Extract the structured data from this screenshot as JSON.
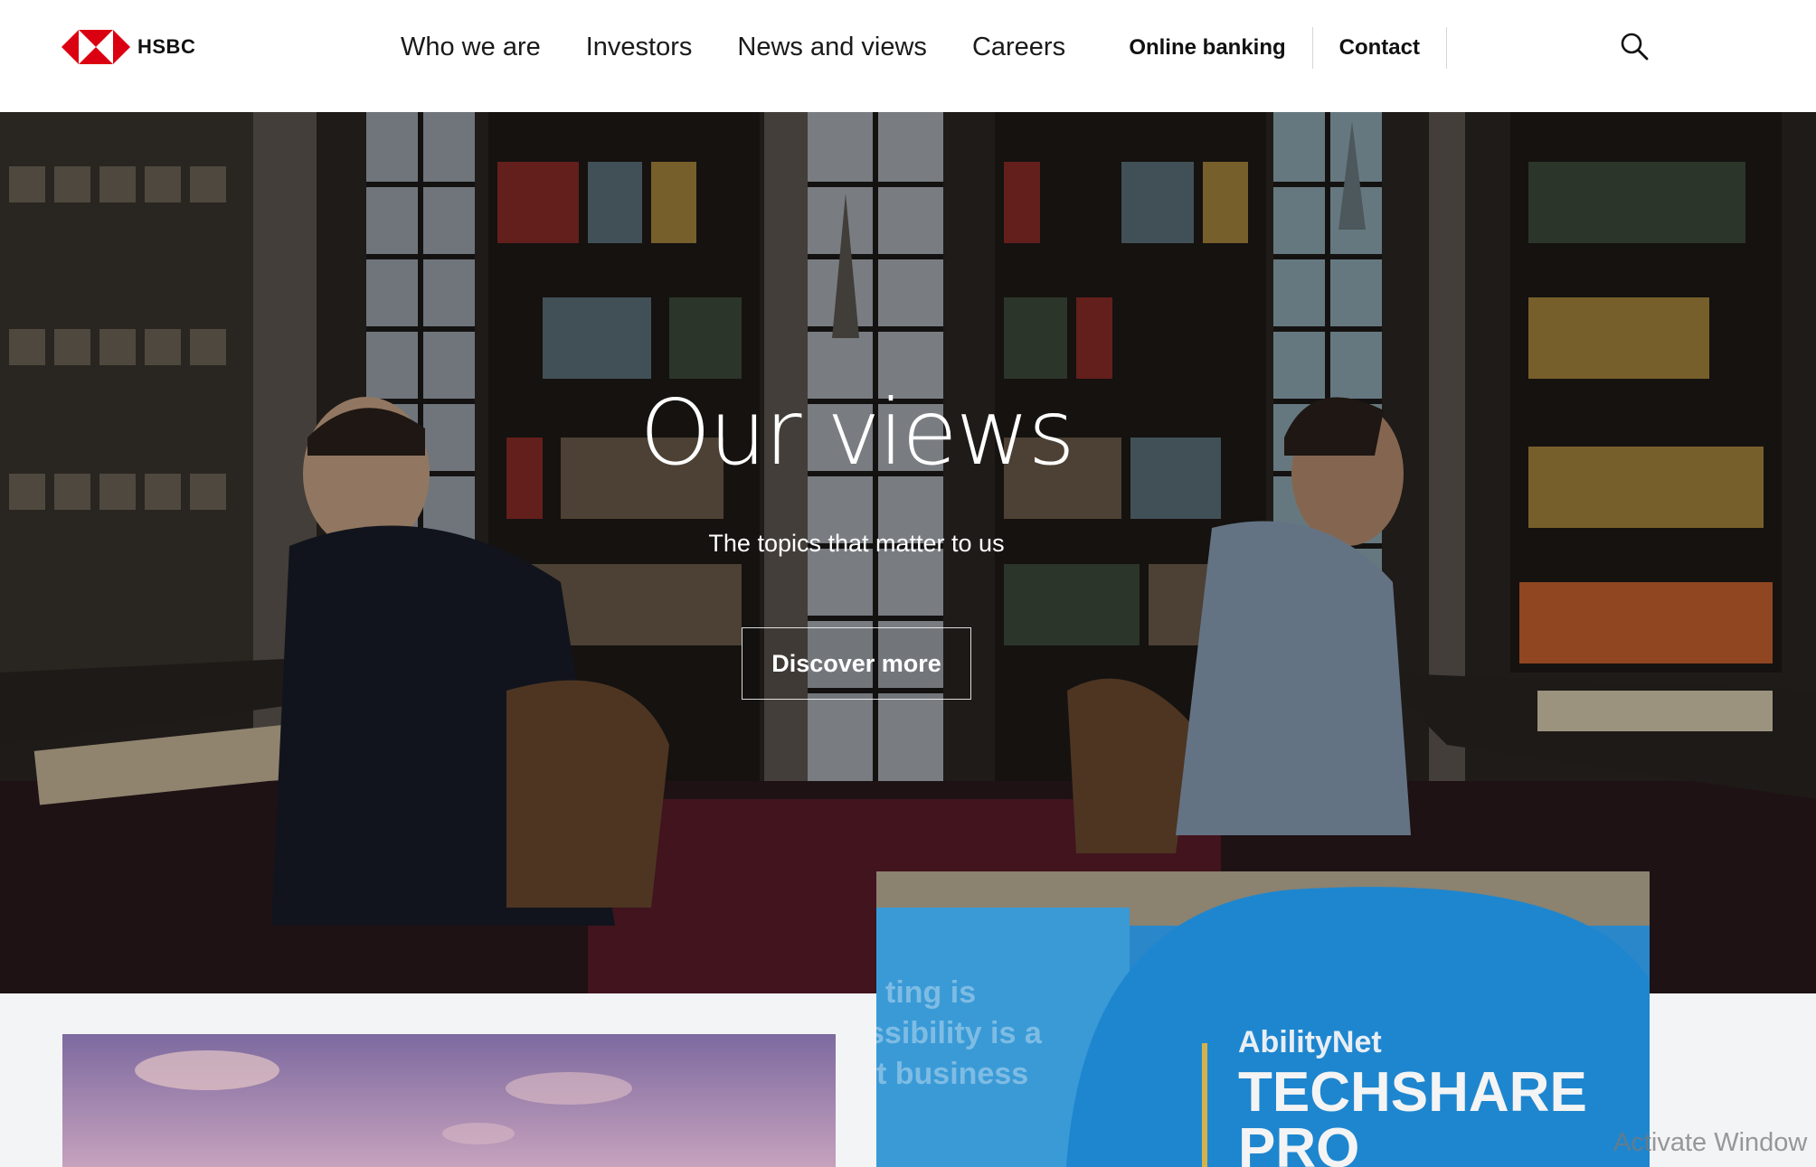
{
  "brand": {
    "name": "HSBC",
    "logo_red": "#db0011",
    "logo_icon": "hsbc-hexagon-icon"
  },
  "nav": {
    "items": [
      {
        "label": "Who we are"
      },
      {
        "label": "Investors"
      },
      {
        "label": "News and views"
      },
      {
        "label": "Careers"
      }
    ]
  },
  "utility": {
    "online_banking": "Online banking",
    "contact": "Contact",
    "search_icon": "search-icon"
  },
  "hero": {
    "title": "Our views",
    "subtitle": "The topics that matter to us",
    "cta": "Discover more"
  },
  "cards": {
    "right": {
      "shirt_line1": "AbilityNet",
      "shirt_line2": "TECHSHARE",
      "shirt_line3": "PRO",
      "background_line1": "ting is",
      "background_line2": "ssibility is a",
      "background_line3": "t business"
    }
  },
  "system": {
    "watermark": "Activate Window"
  }
}
